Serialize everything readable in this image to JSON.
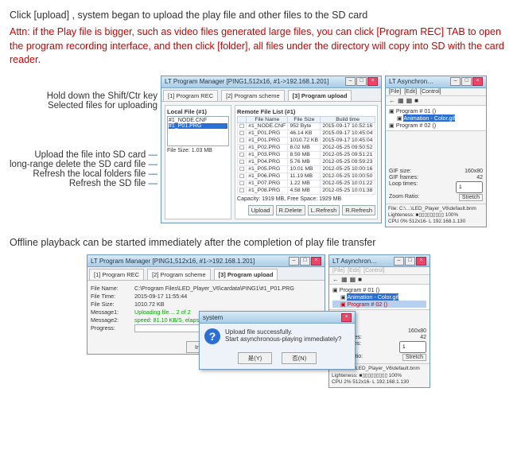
{
  "text": {
    "intro": "Click [upload] , system began to upload the play file and other files to the SD card",
    "attn": "Attn: if the Play file is bigger, such as video files generated large files, you can click [Program REC] TAB to open the program recording interface, and then click [folder], all files under the directory will copy into SD with the card reader.",
    "sub": "Offline playback can be started immediately after the completion of play file transfer"
  },
  "labels": {
    "lt1": "Hold down the Shift/Ctr key",
    "lt2": "Selected files for uploading",
    "lb1": "Upload the file into SD card",
    "lb2": "long-range delete the SD card file",
    "lb3": "Refresh the local folders file",
    "lb4": "Refresh the SD file"
  },
  "pm": {
    "title": "LT Program Manager  [PING1,512x16, #1->192.168.1.201]",
    "tabs": [
      "[1] Program REC",
      "[2] Program scheme",
      "[3] Program upload"
    ],
    "localTitle": "Local File (#1)",
    "remoteTitle": "Remote File List (#1)",
    "localFiles": {
      "sel": "#1_P01.PRG",
      "other": "#1_NODE.CNF"
    },
    "localSize": "File Size: 1.03 MB",
    "remoteHead": [
      "",
      "File Name",
      "File Size",
      "Build time"
    ],
    "remoteRows": [
      [
        "#1_NODE.CNF",
        "952 Byte",
        "2015-09-17 10:52:16"
      ],
      [
        "#1_P01.PRG",
        "46.14 KB",
        "2015-09-17 10:45:04"
      ],
      [
        "#1_P01.PRG",
        "1010.72 KB",
        "2015-09-17 10:45:04"
      ],
      [
        "#1_P02.PRG",
        "8.02 MB",
        "2012-05-25 09:50:52"
      ],
      [
        "#1_P03.PRG",
        "8.59 MB",
        "2012-05-25 09:51:21"
      ],
      [
        "#1_P04.PRG",
        "5.76 MB",
        "2012-05-25 09:59:23"
      ],
      [
        "#1_P05.PRG",
        "10.01 MB",
        "2012-05-25 10:00:16"
      ],
      [
        "#1_P06.PRG",
        "11.19 MB",
        "2012-05-25 10:00:50"
      ],
      [
        "#1_P07.PRG",
        "1.22 MB",
        "2012-05-25 10:01:22"
      ],
      [
        "#1_P08.PRG",
        "4.58 MB",
        "2012-05-25 10:01:38"
      ]
    ],
    "capacity": "Capacity: 1919 MB, Free Space: 1929 MB",
    "btns": {
      "upload": "Upload",
      "rdel": "R.Delete",
      "lref": "L.Refresh",
      "rref": "R.Refresh"
    }
  },
  "async": {
    "title": "LT Asynchron…",
    "menu": [
      "[File]",
      "[Edit]",
      "[Control]"
    ],
    "tool": [
      "←",
      "▦",
      "▦",
      "■"
    ],
    "tree": {
      "prog1": "Program # 01  ()",
      "anim": "Animation - Color.gif",
      "prog2": "Program # 02  ()"
    },
    "props": {
      "gif_k": "GIF size:",
      "gif_v": "160x80",
      "frames_k": "GIF frames:",
      "frames_v": "42",
      "loop_k": "Loop times:",
      "loop_v": "1",
      "zoom_k": "Zoom Ratio:",
      "zoom_v": "Stretch"
    },
    "foot": {
      "file": "File:  C:\\…\\LED_Player_V6\\default.bnm",
      "light": "Lighteness:  ■▯▯▯▯▯▯▯▯▯   100%",
      "cpu": "CPU  0%    512x16- L        192.168.1.130"
    }
  },
  "pm2": {
    "title": "LT Program Manager  [PING1,512x16, #1->192.168.1.201]",
    "tabs": [
      "[1] Program REC",
      "[2] Program scheme",
      "[3] Program upload"
    ],
    "file_k": "File Name:",
    "file_v": "C:\\Program Files\\LED_Player_V6\\cardata\\PING1\\#1_P01.PRG",
    "time_k": "File Time:",
    "time_v": "2015-09-17 11:55:44",
    "size_k": "File Size:",
    "size_v": "1010.72 KB",
    "msg1_k": "Message1:",
    "msg1_v": "Uploading file… 2 of 2",
    "msg2_k": "Message2:",
    "msg2_v": "speed: 81.10 KB/S, elapsed: 00:00:06,  108.000%",
    "prog_k": "Progress:",
    "interrupt": "Interrupt"
  },
  "dlg": {
    "title": "system",
    "l1": "Upload file successfully.",
    "l2": "Start asynchronous-playing immediately?",
    "yes": "是(Y)",
    "no": "否(N)"
  },
  "async2": {
    "props": {
      "gif_v": "160x80",
      "frames_v": "42",
      "loop_v": "1",
      "zoom_v": "Stretch"
    },
    "foot": {
      "file": "File:  C:\\…\\LED_Player_V6\\default.bnm",
      "light": "Lighteness:  ■▯▯▯▯▯▯▯▯▯   100%",
      "cpu": "CPU  2%    512x16- L        192.168.1.130"
    }
  }
}
